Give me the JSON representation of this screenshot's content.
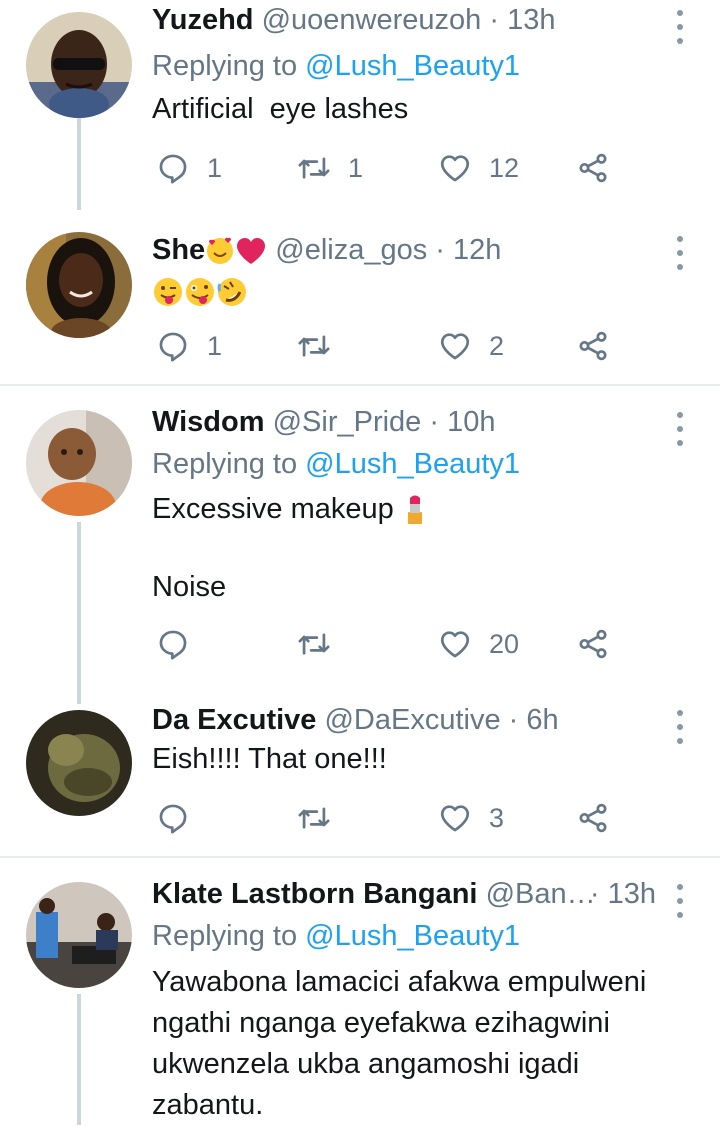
{
  "colors": {
    "link": "#1da1f2",
    "muted": "#657786",
    "thread_line": "#ccd6dd",
    "separator": "#e6ecf0"
  },
  "tweets": [
    {
      "name": "Yuzehd",
      "handle": "@uoenwereuzoh",
      "dot": "·",
      "time": "13h",
      "replying_prefix": "Replying to ",
      "replying_to": "@Lush_Beauty1",
      "text": "Artificial  eye lashes",
      "reply_count": "1",
      "retweet_count": "1",
      "like_count": "12"
    },
    {
      "name": "She",
      "name_emojis": [
        "smiling-face-with-hearts",
        "red-heart"
      ],
      "handle": "@eliza_gos",
      "dot": "·",
      "time": "12h",
      "text_emojis": [
        "winking-face-with-tongue",
        "zany-face",
        "rolling-on-the-floor-laughing"
      ],
      "reply_count": "1",
      "retweet_count": "",
      "like_count": "2"
    },
    {
      "name": "Wisdom",
      "handle": "@Sir_Pride",
      "dot": "·",
      "time": "10h",
      "replying_prefix": "Replying to ",
      "replying_to": "@Lush_Beauty1",
      "text_line1": "Excessive makeup",
      "text_line1_emoji": "lipstick",
      "text_line2": "Noise",
      "reply_count": "",
      "retweet_count": "",
      "like_count": "20"
    },
    {
      "name": "Da Excutive",
      "handle": "@DaExcutive",
      "dot": "·",
      "time": "6h",
      "text": "Eish!!!! That one!!!",
      "reply_count": "",
      "retweet_count": "",
      "like_count": "3"
    },
    {
      "name": "Klate Lastborn Bangani",
      "handle": "@Ban…",
      "dot": "·",
      "time": "13h",
      "replying_prefix": "Replying to ",
      "replying_to": "@Lush_Beauty1",
      "text_lines": [
        "Yawabona lamacici afakwa empulweni",
        "ngathi nganga eyefakwa ezihagwini",
        "ukwenzela ukba angamoshi igadi",
        "zabantu."
      ]
    }
  ]
}
